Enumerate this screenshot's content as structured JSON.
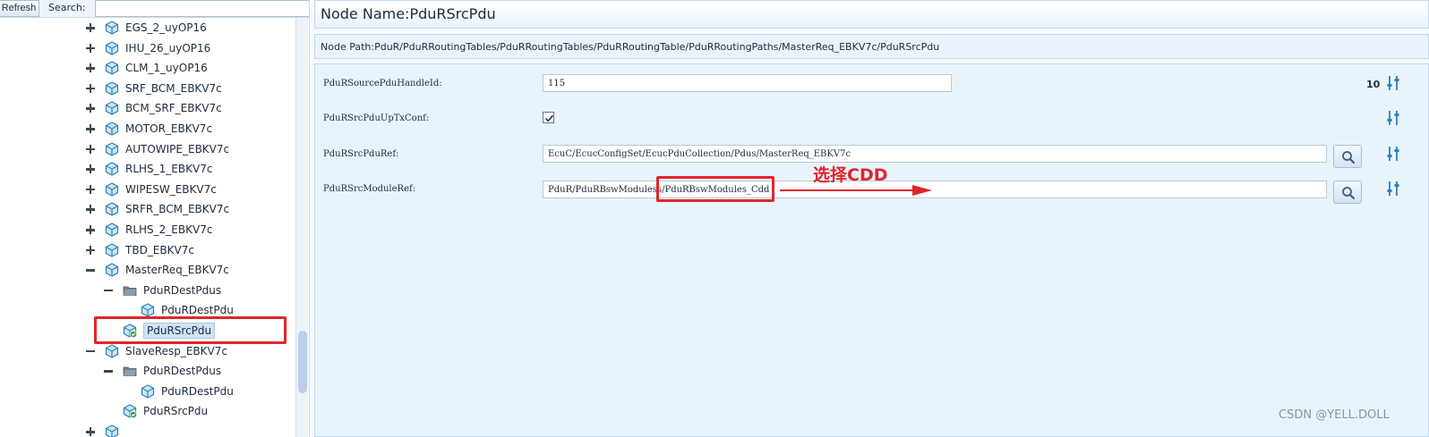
{
  "left": {
    "refresh_label": "Refresh",
    "search_label": "Search:",
    "search_value": "",
    "tree": [
      {
        "label": "EGS_2_uyOP16",
        "indent": 0,
        "toggle": "plus",
        "icon": "config-node"
      },
      {
        "label": "IHU_26_uyOP16",
        "indent": 0,
        "toggle": "plus",
        "icon": "config-node"
      },
      {
        "label": "CLM_1_uyOP16",
        "indent": 0,
        "toggle": "plus",
        "icon": "config-node"
      },
      {
        "label": "SRF_BCM_EBKV7c",
        "indent": 0,
        "toggle": "plus",
        "icon": "config-node"
      },
      {
        "label": "BCM_SRF_EBKV7c",
        "indent": 0,
        "toggle": "plus",
        "icon": "config-node"
      },
      {
        "label": "MOTOR_EBKV7c",
        "indent": 0,
        "toggle": "plus",
        "icon": "config-node"
      },
      {
        "label": "AUTOWIPE_EBKV7c",
        "indent": 0,
        "toggle": "plus",
        "icon": "config-node"
      },
      {
        "label": "RLHS_1_EBKV7c",
        "indent": 0,
        "toggle": "plus",
        "icon": "config-node"
      },
      {
        "label": "WIPESW_EBKV7c",
        "indent": 0,
        "toggle": "plus",
        "icon": "config-node"
      },
      {
        "label": "SRFR_BCM_EBKV7c",
        "indent": 0,
        "toggle": "plus",
        "icon": "config-node"
      },
      {
        "label": "RLHS_2_EBKV7c",
        "indent": 0,
        "toggle": "plus",
        "icon": "config-node"
      },
      {
        "label": "TBD_EBKV7c",
        "indent": 0,
        "toggle": "plus",
        "icon": "config-node"
      },
      {
        "label": "MasterReq_EBKV7c",
        "indent": 0,
        "toggle": "minus",
        "icon": "config-node"
      },
      {
        "label": "PduRDestPdus",
        "indent": 1,
        "toggle": "minus",
        "icon": "folder"
      },
      {
        "label": "PduRDestPdu",
        "indent": 2,
        "toggle": "none",
        "icon": "config-node"
      },
      {
        "label": "PduRSrcPdu",
        "indent": 1,
        "toggle": "none",
        "icon": "config-node-ok",
        "selected": true
      },
      {
        "label": "SlaveResp_EBKV7c",
        "indent": 0,
        "toggle": "minus",
        "icon": "config-node"
      },
      {
        "label": "PduRDestPdus",
        "indent": 1,
        "toggle": "minus",
        "icon": "folder"
      },
      {
        "label": "PduRDestPdu",
        "indent": 2,
        "toggle": "none",
        "icon": "config-node"
      },
      {
        "label": "PduRSrcPdu",
        "indent": 1,
        "toggle": "none",
        "icon": "config-node-ok"
      },
      {
        "label": "",
        "indent": 0,
        "toggle": "plus",
        "icon": "config-node"
      }
    ]
  },
  "right": {
    "node_name": "Node Name:PduRSrcPdu",
    "node_path": "Node Path:PduR/PduRRoutingTables/PduRRoutingTables/PduRRoutingTable/PduRRoutingPaths/MasterReq_EBKV7c/PduRSrcPdu",
    "count": "10",
    "params": {
      "handle_id_label": "PduRSourcePduHandleId:",
      "handle_id_value": "115",
      "uptxconf_label": "PduRSrcPduUpTxConf:",
      "uptxconf_checked": true,
      "srcpduref_label": "PduRSrcPduRef:",
      "srcpduref_value": "EcuC/EcucConfigSet/EcucPduCollection/Pdus/MasterReq_EBKV7c",
      "moduleref_label": "PduRSrcModuleRef:",
      "moduleref_value": "PduR/PduRBswModuless/PduRBswModules_Cdd"
    }
  },
  "annotation": {
    "text": "选择CDD",
    "color": "#e0262b"
  },
  "watermark": "CSDN @YELL.DOLL",
  "colors": {
    "accent": "#2f7fb7",
    "highlight_red": "#e0262b",
    "ok_green": "#3aa548"
  },
  "icons": {
    "config_node": "cube-icon",
    "folder": "folder-icon",
    "lookup": "magnifier-icon",
    "tune": "sliders-icon"
  }
}
